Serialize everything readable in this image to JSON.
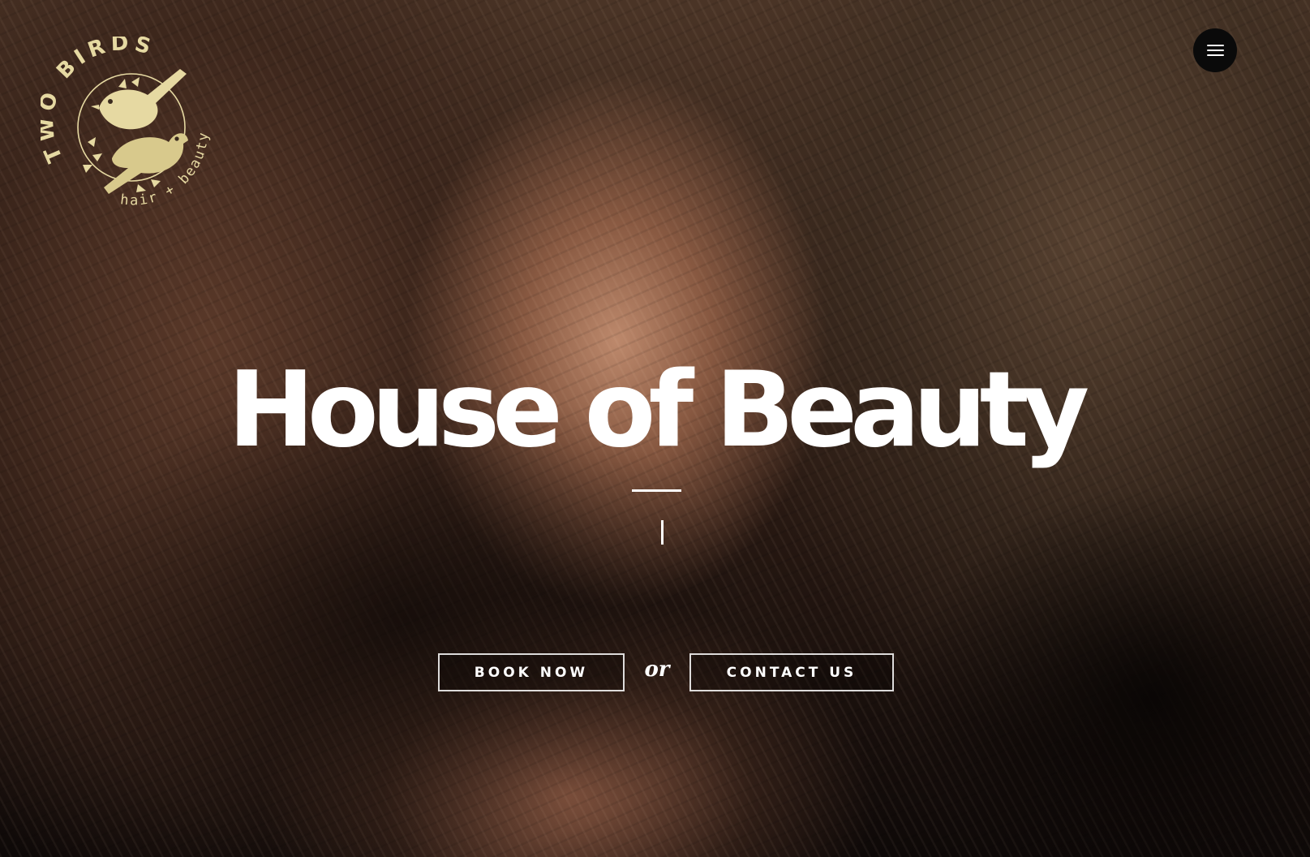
{
  "brand": {
    "top_text": "TWO BIRDS",
    "bottom_text": "hair + beauty",
    "logo_color": "#e6d9a2"
  },
  "header": {
    "menu_icon": "hamburger-menu-icon"
  },
  "hero": {
    "headline": "House of Beauty",
    "typed_text": "",
    "book_button_label": "BOOK NOW",
    "separator_text": "or",
    "contact_button_label": "CONTACT US"
  }
}
